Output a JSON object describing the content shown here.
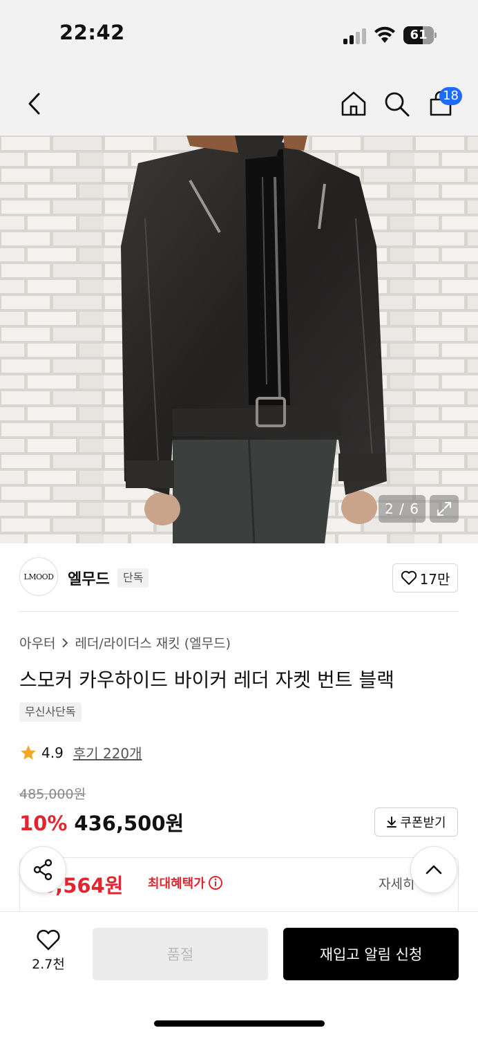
{
  "status_bar": {
    "time": "22:42",
    "battery_percent": "61",
    "signal_bars_active": 2,
    "signal_bars_total": 4
  },
  "header": {
    "cart_count": "18",
    "icons": [
      "back-chevron-icon",
      "home-icon",
      "search-icon",
      "shopping-bag-icon"
    ]
  },
  "gallery": {
    "counter": "2 / 6",
    "current": 2,
    "total": 6
  },
  "brand": {
    "logo_text": "LMOOD",
    "name": "엘무드",
    "tag": "단독",
    "likes": "17만"
  },
  "product": {
    "breadcrumb": [
      "아우터",
      "레더/라이더스 재킷 (엘무드)"
    ],
    "title": "스모커 카우하이드 바이커 레더 자켓 번트 블랙",
    "badge": "무신사단독",
    "rating": "4.9",
    "reviews": "후기 220개"
  },
  "pricing": {
    "original_price": "485,000원",
    "discount": "10%",
    "price": "436,500원",
    "coupon_label": "쿠폰받기",
    "max_benefit_price": "3,564원",
    "max_benefit_label": "최대혜택가",
    "details_label": "자세히"
  },
  "bottom_bar": {
    "wish_count": "2.7천",
    "soldout_label": "품절",
    "restock_label": "재입고 알림 신청"
  },
  "colors": {
    "accent_red": "#e0262e",
    "badge_blue": "#1f6bff",
    "star": "#f5a623"
  }
}
